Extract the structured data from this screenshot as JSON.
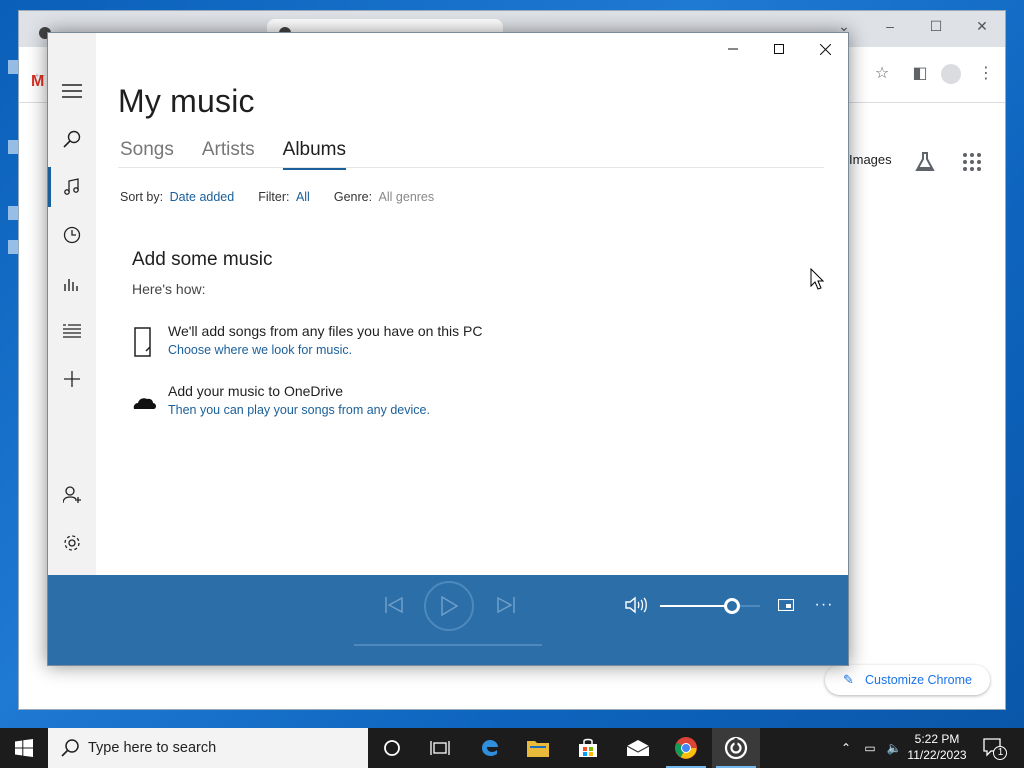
{
  "chrome": {
    "images_link": "Images",
    "customize_label": "Customize Chrome"
  },
  "groove": {
    "title": "My music",
    "tabs": [
      {
        "label": "Songs",
        "active": false
      },
      {
        "label": "Artists",
        "active": false
      },
      {
        "label": "Albums",
        "active": true
      }
    ],
    "filters": {
      "sort_label": "Sort by:",
      "sort_value": "Date added",
      "filter_label": "Filter:",
      "filter_value": "All",
      "genre_label": "Genre:",
      "genre_value": "All genres"
    },
    "empty": {
      "title": "Add some music",
      "subtitle": "Here's how:",
      "items": [
        {
          "icon": "folder-icon",
          "text": "We'll add songs from any files you have on this PC",
          "link": "Choose where we look for music."
        },
        {
          "icon": "onedrive-cloud-icon",
          "text": "Add your music to OneDrive",
          "link": "Then you can play your songs from any device."
        }
      ]
    },
    "sidebar": [
      "hamburger-menu-icon",
      "search-icon",
      "music-note-icon",
      "recent-clock-icon",
      "now-playing-bars-icon",
      "playlists-icon",
      "add-playlist-plus-icon",
      "account-person-icon",
      "settings-gear-icon"
    ],
    "player": {
      "volume_level": 0.72,
      "accent": "#2b6ea8"
    }
  },
  "taskbar": {
    "search_placeholder": "Type here to search",
    "time": "5:22 PM",
    "date": "11/22/2023",
    "notification_count": "1"
  },
  "colors": {
    "accent_blue": "#1a5f99",
    "player_bg": "#2b6ea8",
    "taskbar_bg": "#1c1c1c"
  }
}
